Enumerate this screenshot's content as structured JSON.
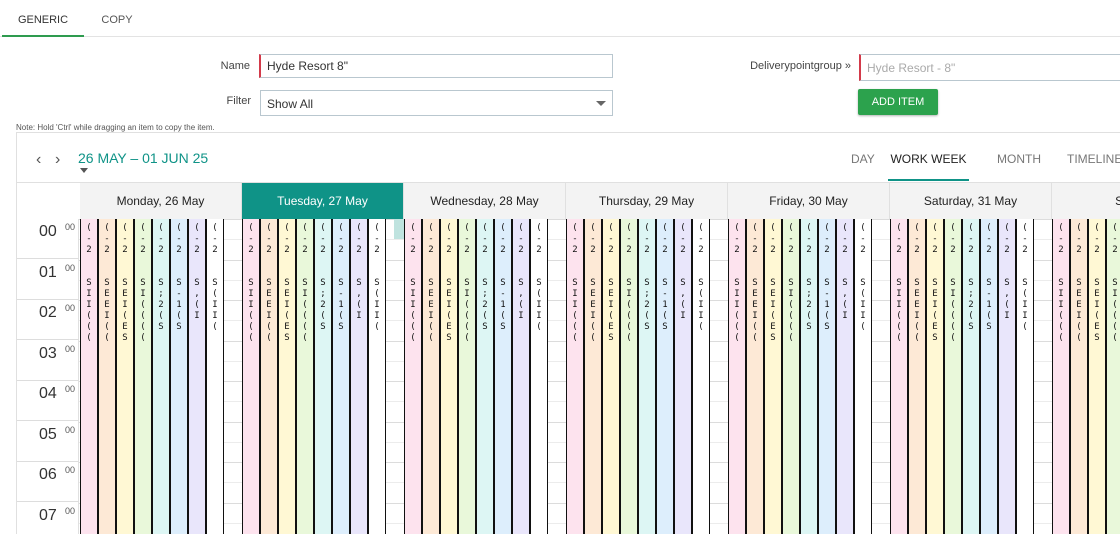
{
  "tabs": [
    {
      "label": "GENERIC",
      "active": true
    },
    {
      "label": "COPY",
      "active": false
    }
  ],
  "form": {
    "name_label": "Name",
    "name_value": "Hyde Resort 8\"",
    "filter_label": "Filter",
    "filter_value": "Show All",
    "dpg_label": "Deliverypointgroup »",
    "dpg_placeholder": "Hyde Resort - 8\"",
    "add_item_label": "ADD ITEM",
    "note": "Note: Hold 'Ctrl' while dragging an item to copy the item."
  },
  "scheduler": {
    "prev_icon": "chevron-left-icon",
    "next_icon": "chevron-right-icon",
    "prev_glyph": "‹",
    "next_glyph": "›",
    "date_range": "26 MAY – 01 JUN 25",
    "views": [
      {
        "label": "DAY",
        "active": false
      },
      {
        "label": "WORK WEEK",
        "active": true
      },
      {
        "label": "MONTH",
        "active": false
      },
      {
        "label": "TIMELINE",
        "active": false
      }
    ],
    "days": [
      {
        "label": "Monday, 26 May",
        "today": false
      },
      {
        "label": "Tuesday, 27 May",
        "today": true
      },
      {
        "label": "Wednesday, 28 May",
        "today": false
      },
      {
        "label": "Thursday, 29 May",
        "today": false
      },
      {
        "label": "Friday, 30 May",
        "today": false
      },
      {
        "label": "Saturday, 31 May",
        "today": false
      },
      {
        "label": "Sunda",
        "today": false
      }
    ],
    "hours": [
      {
        "h": "00",
        "m": "00"
      },
      {
        "h": "01",
        "m": "00"
      },
      {
        "h": "02",
        "m": "00"
      },
      {
        "h": "03",
        "m": "00"
      },
      {
        "h": "04",
        "m": "00"
      },
      {
        "h": "05",
        "m": "00"
      },
      {
        "h": "06",
        "m": "00"
      },
      {
        "h": "07",
        "m": "00"
      }
    ],
    "resource_colors": [
      "#fde3ee",
      "#fde9d6",
      "#fff8d4",
      "#e9f8da",
      "#ddf6f4",
      "#ddeefc",
      "#e9e6fb",
      "#ffffff"
    ],
    "event_glyphs": [
      "( - 2 S I I ( ( (",
      "( - 2 S E E I ( (",
      "( - 2 S E I ( E S",
      "( - 2 S I ( ( ( (",
      "( - 2 S ; 2 ( S",
      "( - 2 S - 1 ( S",
      "( - 2 S , ( I",
      "( - 2 S ( I I ("
    ]
  }
}
